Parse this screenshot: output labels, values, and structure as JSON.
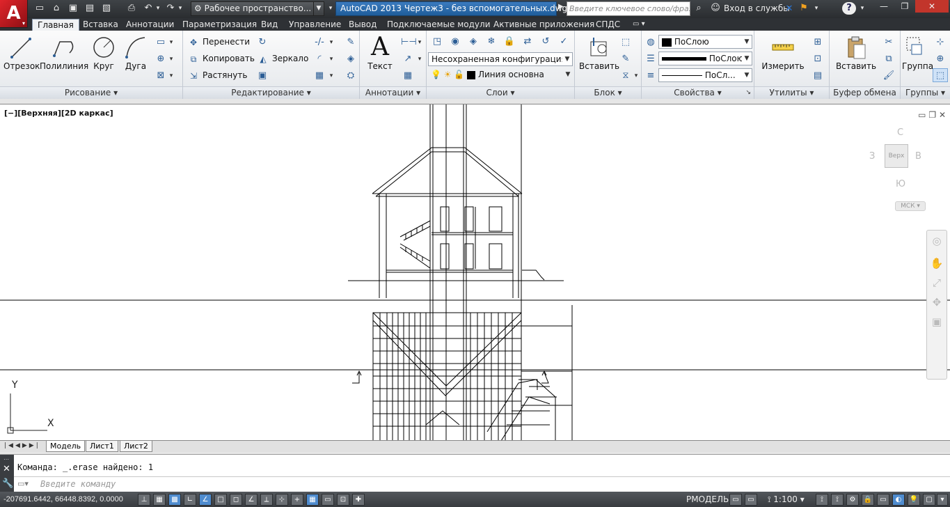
{
  "titlebar": {
    "workspace": "Рабочее пространство...",
    "title": "AutoCAD 2013   Чертеж3 - без вспомогательных.dwg",
    "search_placeholder": "Введите ключевое слово/фразу",
    "login": "Вход в службы"
  },
  "menu": {
    "tabs": [
      "Главная",
      "Вставка",
      "Аннотации",
      "Параметризация",
      "Вид",
      "Управление",
      "Вывод",
      "Подключаемые модули",
      "Активные приложения",
      "СПДС"
    ]
  },
  "ribbon": {
    "draw": {
      "title": "Рисование",
      "line": "Отрезок",
      "polyline": "Полилиния",
      "circle": "Круг",
      "arc": "Дуга"
    },
    "modify": {
      "title": "Редактирование",
      "move": "Перенести",
      "copy": "Копировать",
      "stretch": "Растянуть",
      "mirror": "Зеркало"
    },
    "annotation": {
      "title": "Аннотации",
      "text": "Текст"
    },
    "layers": {
      "title": "Слои",
      "config": "Несохраненная конфигурация сло",
      "layer": "Линия основна"
    },
    "block": {
      "title": "Блок",
      "insert": "Вставить"
    },
    "properties": {
      "title": "Свойства",
      "color": "ПоСлою",
      "lineweight": "ПоСлоюк",
      "linetype": "ПоСл..."
    },
    "utilities": {
      "title": "Утилиты",
      "measure": "Измерить"
    },
    "clipboard": {
      "title": "Буфер обмена",
      "paste": "Вставить"
    },
    "groups": {
      "title": "Группы",
      "group": "Группа"
    }
  },
  "viewport": {
    "label": "[−][Верхняя][2D каркас]",
    "viewcube": {
      "north": "С",
      "south": "Ю",
      "west": "З",
      "east": "В",
      "face": "Верх",
      "ucs": "МСК"
    },
    "axis_y": "Y",
    "axis_x": "X"
  },
  "layout_tabs": [
    "Модель",
    "Лист1",
    "Лист2"
  ],
  "command": {
    "history": "Команда: _.erase найдено: 1",
    "placeholder": "Введите команду"
  },
  "status": {
    "coords": "-207691.6442, 66448.8392, 0.0000",
    "space": "РМОДЕЛЬ",
    "scale": "1:100"
  },
  "colors": {
    "accent": "#1f5d9a",
    "ribbon_bg": "#e4e7eb",
    "canvas": "#ffffff",
    "status_bg": "#383b3f"
  }
}
